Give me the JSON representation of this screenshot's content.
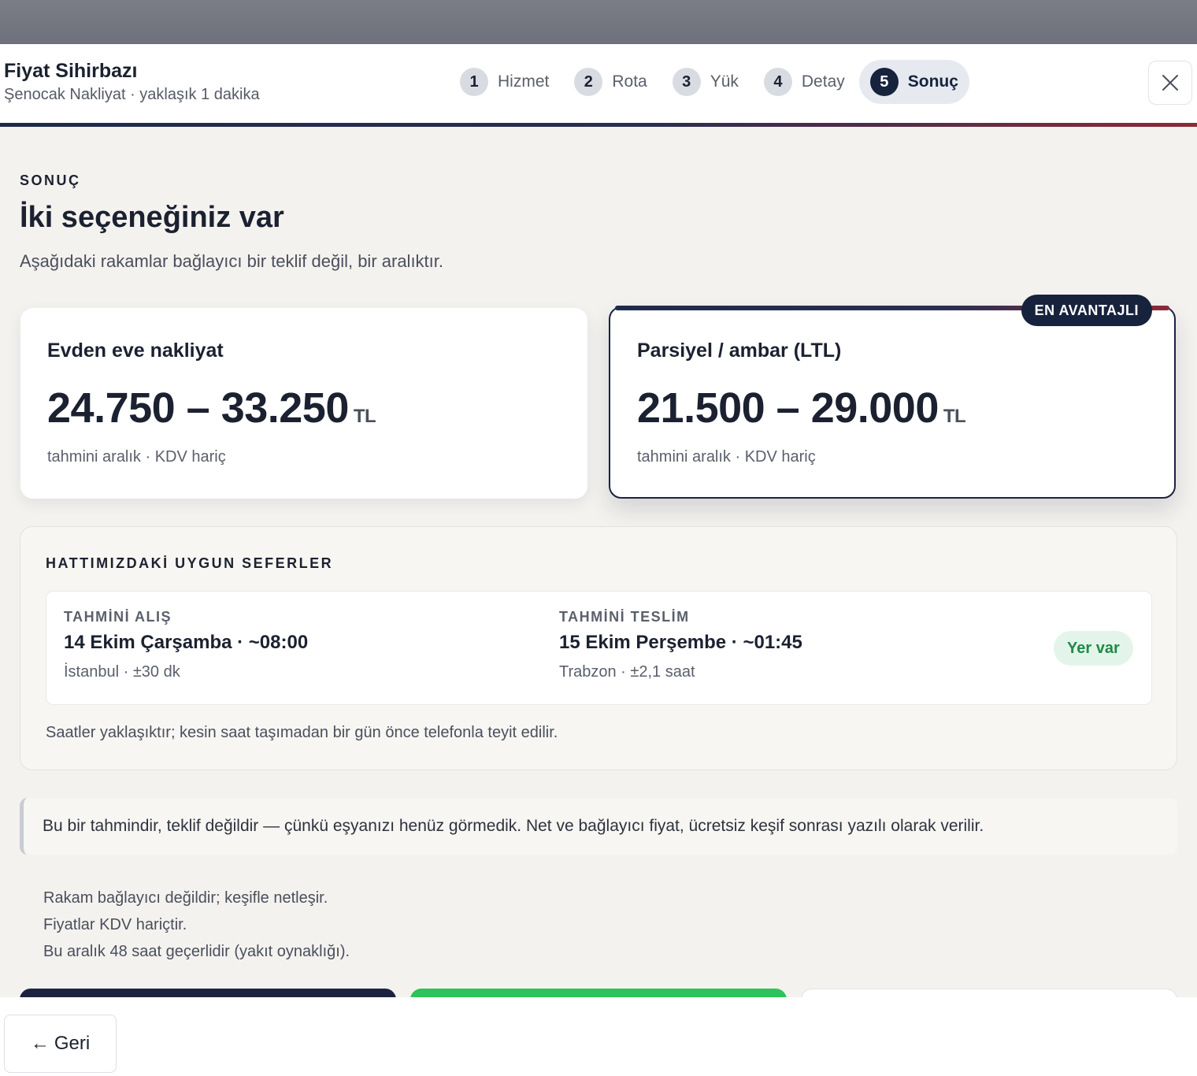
{
  "header": {
    "title": "Fiyat Sihirbazı",
    "subtitle": "Şenocak Nakliyat · yaklaşık 1 dakika",
    "close_icon": "close-icon",
    "steps": [
      {
        "num": "1",
        "label": "Hizmet",
        "active": false
      },
      {
        "num": "2",
        "label": "Rota",
        "active": false
      },
      {
        "num": "3",
        "label": "Yük",
        "active": false
      },
      {
        "num": "4",
        "label": "Detay",
        "active": false
      },
      {
        "num": "5",
        "label": "Sonuç",
        "active": true
      }
    ]
  },
  "result": {
    "eyebrow": "SONUÇ",
    "heading": "İki seçeneğiniz var",
    "lead": "Aşağıdaki rakamlar bağlayıcı bir teklif değil, bir aralıktır.",
    "options": [
      {
        "name": "Evden eve nakliyat",
        "price": "24.750 – 33.250",
        "currency": "TL",
        "note": "tahmini aralık · KDV hariç"
      },
      {
        "name": "Parsiyel / ambar (LTL)",
        "price": "21.500 – 29.000",
        "currency": "TL",
        "note": "tahmini aralık · KDV hariç",
        "badge": "EN AVANTAJLI"
      }
    ]
  },
  "trips": {
    "title": "HATTIMIZDAKİ UYGUN SEFERLER",
    "pickup_label": "TAHMİNİ ALIŞ",
    "pickup_value": "14 Ekim Çarşamba · ~08:00",
    "pickup_sub": "İstanbul · ±30 dk",
    "delivery_label": "TAHMİNİ TESLİM",
    "delivery_value": "15 Ekim Perşembe · ~01:45",
    "delivery_sub": "Trabzon · ±2,1 saat",
    "status": "Yer var",
    "footnote": "Saatler yaklaşıktır; kesin saat taşımadan bir gün önce telefonla teyit edilir."
  },
  "callout": "Bu bir tahmindir, teklif değildir — çünkü eşyanızı henüz görmedik. Net ve bağlayıcı fiyat, ücretsiz keşif sonrası yazılı olarak verilir.",
  "disclaimers": [
    "Rakam bağlayıcı değildir; keşifle netleşir.",
    "Fiyatlar KDV hariçtir.",
    "Bu aralık 48 saat geçerlidir (yakıt oynaklığı)."
  ],
  "footer": {
    "back_label": "Geri",
    "back_arrow": "←"
  },
  "colors": {
    "navy": "#17223d",
    "accent_red": "#8e2a38",
    "green": "#2ec25a",
    "status_green": "#1e8a45"
  }
}
